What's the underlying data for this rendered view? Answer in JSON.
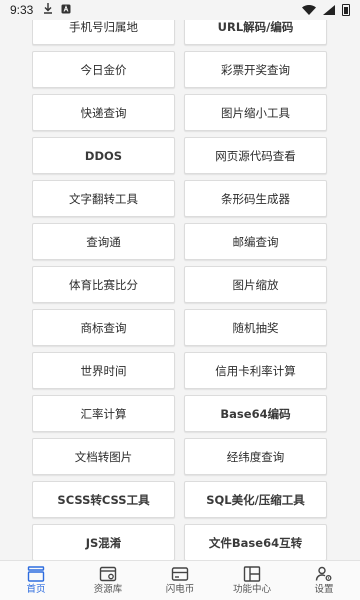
{
  "status": {
    "time": "9:33"
  },
  "tools": [
    {
      "label": "手机号归属地",
      "bold": false
    },
    {
      "label": "URL解码/编码",
      "bold": true
    },
    {
      "label": "今日金价",
      "bold": false
    },
    {
      "label": "彩票开奖查询",
      "bold": false
    },
    {
      "label": "快递查询",
      "bold": false
    },
    {
      "label": "图片缩小工具",
      "bold": false
    },
    {
      "label": "DDOS",
      "bold": true
    },
    {
      "label": "网页源代码查看",
      "bold": false
    },
    {
      "label": "文字翻转工具",
      "bold": false
    },
    {
      "label": "条形码生成器",
      "bold": false
    },
    {
      "label": "查询通",
      "bold": false
    },
    {
      "label": "邮编查询",
      "bold": false
    },
    {
      "label": "体育比赛比分",
      "bold": false
    },
    {
      "label": "图片缩放",
      "bold": false
    },
    {
      "label": "商标查询",
      "bold": false
    },
    {
      "label": "随机抽奖",
      "bold": false
    },
    {
      "label": "世界时间",
      "bold": false
    },
    {
      "label": "信用卡利率计算",
      "bold": false
    },
    {
      "label": "汇率计算",
      "bold": false
    },
    {
      "label": "Base64编码",
      "bold": true
    },
    {
      "label": "文档转图片",
      "bold": false
    },
    {
      "label": "经纬度查询",
      "bold": false
    },
    {
      "label": "SCSS转CSS工具",
      "bold": true
    },
    {
      "label": "SQL美化/压缩工具",
      "bold": true
    },
    {
      "label": "JS混淆",
      "bold": true
    },
    {
      "label": "文件Base64互转",
      "bold": true
    }
  ],
  "tabbar": {
    "items": [
      {
        "label": "首页",
        "icon": "home-icon",
        "active": true
      },
      {
        "label": "资源库",
        "icon": "library-icon",
        "active": false
      },
      {
        "label": "闪电币",
        "icon": "wallet-icon",
        "active": false
      },
      {
        "label": "功能中心",
        "icon": "grid-panel-icon",
        "active": false
      },
      {
        "label": "设置",
        "icon": "user-settings-icon",
        "active": false
      }
    ]
  },
  "colors": {
    "accent": "#2d6cdf",
    "tile_bg": "#ffffff",
    "page_bg": "#f4f4f4"
  }
}
